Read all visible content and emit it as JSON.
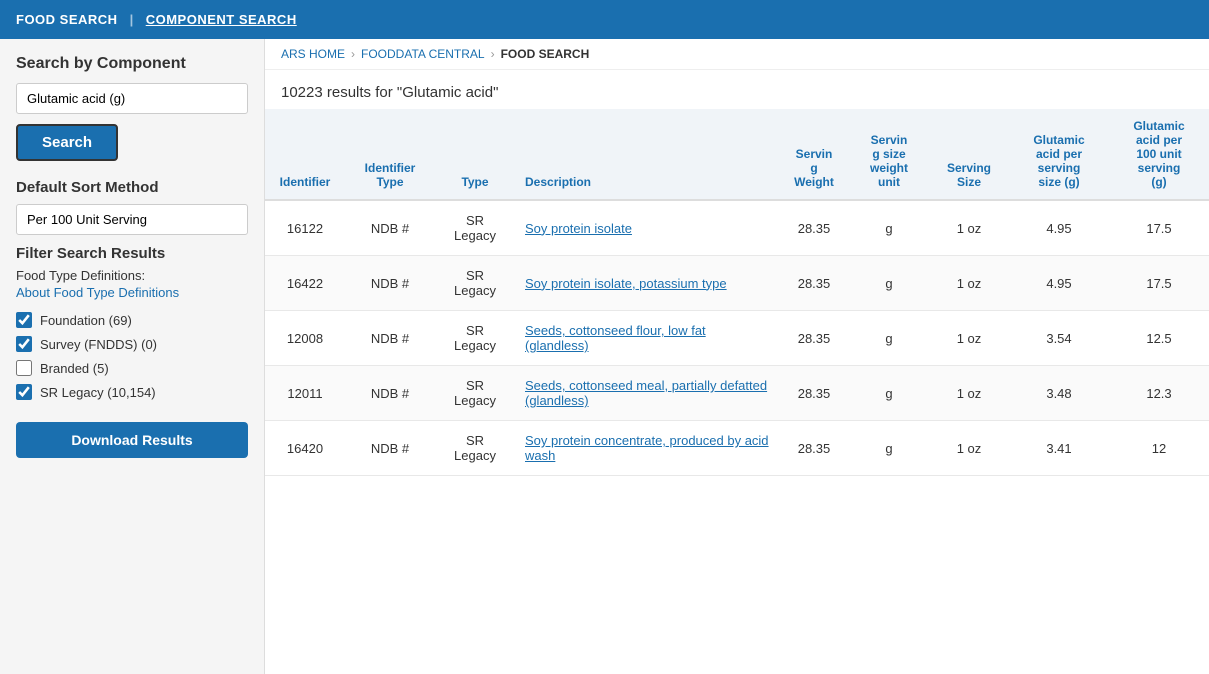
{
  "topnav": {
    "food_search": "FOOD SEARCH",
    "separator": "|",
    "component_search": "COMPONENT SEARCH"
  },
  "breadcrumb": {
    "ars_home": "ARS HOME",
    "fooddata_central": "FOODDATA CENTRAL",
    "food_search": "FOOD SEARCH"
  },
  "results_summary": "10223 results for \"Glutamic acid\"",
  "sidebar": {
    "search_by_component_title": "Search by Component",
    "search_input_value": "Glutamic acid (g)",
    "search_input_placeholder": "Glutamic acid (g)",
    "search_button_label": "Search",
    "default_sort_title": "Default Sort Method",
    "sort_input_value": "Per 100 Unit Serving",
    "filter_title": "Filter Search Results",
    "food_type_label": "Food Type Definitions:",
    "food_type_link": "About Food Type Definitions",
    "checkboxes": [
      {
        "label": "Foundation  (69)",
        "checked": true
      },
      {
        "label": "Survey (FNDDS)  (0)",
        "checked": true
      },
      {
        "label": "Branded  (5)",
        "checked": false
      },
      {
        "label": "SR Legacy  (10,154)",
        "checked": true
      }
    ],
    "download_button_label": "Download Results"
  },
  "table": {
    "headers": [
      "Identifier",
      "Identifier Type",
      "Type",
      "Description",
      "Serving Weight",
      "Serving size weight unit",
      "Serving Size",
      "Glutamic acid per serving size (g)",
      "Glutamic acid per 100 unit serving (g)"
    ],
    "rows": [
      {
        "identifier": "16122",
        "id_type": "NDB #",
        "type": "SR Legacy",
        "description": "Soy protein isolate",
        "desc_link": true,
        "serving_weight": "28.35",
        "ssw_unit": "g",
        "serving_size": "1 oz",
        "ga_per_ss": "4.95",
        "ga_per_100": "17.5"
      },
      {
        "identifier": "16422",
        "id_type": "NDB #",
        "type": "SR Legacy",
        "description": "Soy protein isolate, potassium type",
        "desc_link": true,
        "serving_weight": "28.35",
        "ssw_unit": "g",
        "serving_size": "1 oz",
        "ga_per_ss": "4.95",
        "ga_per_100": "17.5"
      },
      {
        "identifier": "12008",
        "id_type": "NDB #",
        "type": "SR Legacy",
        "description": "Seeds, cottonseed flour, low fat (glandless)",
        "desc_link": true,
        "serving_weight": "28.35",
        "ssw_unit": "g",
        "serving_size": "1 oz",
        "ga_per_ss": "3.54",
        "ga_per_100": "12.5"
      },
      {
        "identifier": "12011",
        "id_type": "NDB #",
        "type": "SR Legacy",
        "description": "Seeds, cottonseed meal, partially defatted (glandless)",
        "desc_link": true,
        "serving_weight": "28.35",
        "ssw_unit": "g",
        "serving_size": "1 oz",
        "ga_per_ss": "3.48",
        "ga_per_100": "12.3"
      },
      {
        "identifier": "16420",
        "id_type": "NDB #",
        "type": "SR Legacy",
        "description": "Soy protein concentrate, produced by acid wash",
        "desc_link": true,
        "serving_weight": "28.35",
        "ssw_unit": "g",
        "serving_size": "1 oz",
        "ga_per_ss": "3.41",
        "ga_per_100": "12"
      }
    ]
  }
}
